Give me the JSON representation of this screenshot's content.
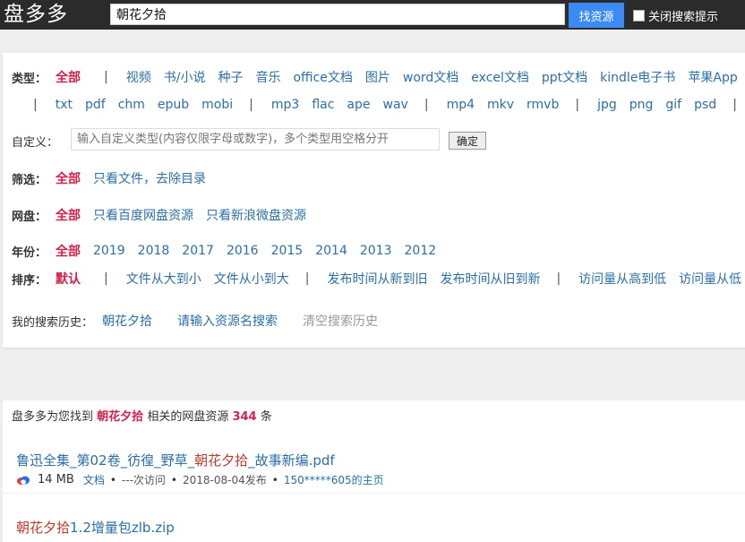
{
  "header": {
    "logo": "盘多多",
    "search_value": "朝花夕拾",
    "search_button": "找资源",
    "suggest_toggle_label": "关闭搜索提示"
  },
  "filters": {
    "type_label": "类型：",
    "type_row1": [
      "全部",
      "视频",
      "书/小说",
      "种子",
      "音乐",
      "office文档",
      "图片",
      "word文档",
      "excel文档",
      "ppt文档",
      "kindle电子书",
      "苹果App"
    ],
    "type_row2_group1": [
      "txt",
      "pdf",
      "chm",
      "epub",
      "mobi"
    ],
    "type_row2_group2": [
      "mp3",
      "flac",
      "ape",
      "wav"
    ],
    "type_row2_group3": [
      "mp4",
      "mkv",
      "rmvb"
    ],
    "type_row2_group4": [
      "jpg",
      "png",
      "gif",
      "psd"
    ],
    "separator": "|",
    "custom_label": "自定义：",
    "custom_placeholder": "输入自定义类型(内容仅限字母或数字)，多个类型用空格分开",
    "custom_ok": "确定",
    "screen_label": "筛选：",
    "screen_items": [
      "全部",
      "只看文件，去除目录"
    ],
    "disk_label": "网盘：",
    "disk_items": [
      "全部",
      "只看百度网盘资源",
      "只看新浪微盘资源"
    ],
    "year_label": "年份：",
    "year_items": [
      "全部",
      "2019",
      "2018",
      "2017",
      "2016",
      "2015",
      "2014",
      "2013",
      "2012"
    ],
    "sort_label": "排序：",
    "sort_default": "默认",
    "sort_group1": [
      "文件从大到小",
      "文件从小到大"
    ],
    "sort_group2": [
      "发布时间从新到旧",
      "发布时间从旧到新"
    ],
    "sort_group3": [
      "访问量从高到低",
      "访问量从低"
    ],
    "history_label": "我的搜索历史：",
    "history_items": [
      "朝花夕拾",
      "请输入资源名搜索"
    ],
    "history_clear": "清空搜索历史"
  },
  "results": {
    "summary_prefix": "盘多多为您找到",
    "summary_keyword": "朝花夕拾",
    "summary_mid": "相关的网盘资源",
    "summary_count": "344",
    "summary_suffix": "条",
    "items": [
      {
        "title_pre": "鲁迅全集_第02卷_彷徨_野草_",
        "title_hl": "朝花夕拾",
        "title_post": "_故事新编.pdf",
        "size": "14 MB",
        "kind": "文档",
        "visits": "---次访问",
        "date": "2018-08-04发布",
        "owner": "150*****605的主页"
      },
      {
        "title_pre": "",
        "title_hl": "朝花夕拾",
        "title_post": "1.2增量包zlb.zip"
      }
    ]
  },
  "colors": {
    "topbar": "#2b2b2b",
    "accent": "#3b8af5",
    "active": "#d6204c",
    "link": "#2a6fa8"
  }
}
